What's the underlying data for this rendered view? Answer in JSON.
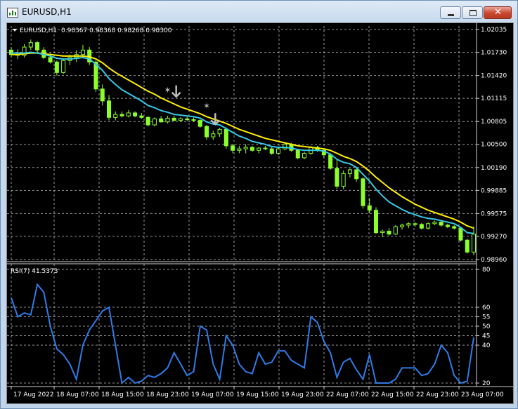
{
  "window": {
    "title": "EURUSD,H1",
    "minimize_glyph": "",
    "maximize_glyph": "",
    "close_glyph": "✕"
  },
  "main_panel": {
    "label_symbol": "EURUSD,H1",
    "label_values": "0.98367 0.98368 0.98268 0.98300",
    "price_levels": [
      "1.02035",
      "1.01730",
      "1.01420",
      "1.01115",
      "1.00805",
      "1.00500",
      "1.00190",
      "0.99885",
      "0.99575",
      "0.99270",
      "0.98960"
    ]
  },
  "rsi_panel": {
    "label": "RSI(7) 41.5373",
    "levels": [
      "80",
      "60",
      "55",
      "50",
      "45",
      "40",
      "20"
    ]
  },
  "time_axis": [
    "17 Aug 2022",
    "18 Aug 07:00",
    "18 Aug 15:00",
    "18 Aug 23:00",
    "19 Aug 07:00",
    "19 Aug 15:00",
    "19 Aug 23:00",
    "22 Aug 07:00",
    "22 Aug 15:00",
    "22 Aug 23:00",
    "23 Aug 07:00"
  ],
  "colors": {
    "background": "#000000",
    "grid": "#c8c8c8",
    "bull": "#8cff2a",
    "bear": "#8cff2a",
    "ma_fast": "#35c8e6",
    "ma_slow": "#ffee00",
    "rsi": "#2f7be8",
    "arrow": "#bdbdbd"
  },
  "icons": {
    "app": "chart-window-icon",
    "panel_marker": "triangle-down-icon",
    "signals": "down-arrow-icon"
  },
  "chart_data": {
    "type": "candlestick",
    "symbol": "EURUSD",
    "timeframe": "H1",
    "ylim": [
      0.9896,
      1.02035
    ],
    "ohlc": [
      [
        1.0176,
        1.018,
        1.0166,
        1.017
      ],
      [
        1.017,
        1.0177,
        1.0164,
        1.0169
      ],
      [
        1.0169,
        1.0184,
        1.0166,
        1.018
      ],
      [
        1.018,
        1.019,
        1.0176,
        1.0186
      ],
      [
        1.0186,
        1.0188,
        1.0173,
        1.0176
      ],
      [
        1.0176,
        1.018,
        1.0164,
        1.0166
      ],
      [
        1.0166,
        1.0172,
        1.0158,
        1.016
      ],
      [
        1.016,
        1.0162,
        1.0142,
        1.0146
      ],
      [
        1.0146,
        1.0164,
        1.0144,
        1.0162
      ],
      [
        1.0162,
        1.017,
        1.0156,
        1.0166
      ],
      [
        1.0166,
        1.0176,
        1.016,
        1.017
      ],
      [
        1.017,
        1.0183,
        1.0165,
        1.0176
      ],
      [
        1.0176,
        1.018,
        1.0156,
        1.016
      ],
      [
        1.016,
        1.0162,
        1.012,
        1.0124
      ],
      [
        1.0124,
        1.013,
        1.0102,
        1.0108
      ],
      [
        1.0108,
        1.0116,
        1.0082,
        1.0086
      ],
      [
        1.0086,
        1.0094,
        1.0082,
        1.009
      ],
      [
        1.009,
        1.0094,
        1.0086,
        1.0088
      ],
      [
        1.0088,
        1.0096,
        1.0086,
        1.0092
      ],
      [
        1.0092,
        1.0094,
        1.0086,
        1.0088
      ],
      [
        1.0088,
        1.0092,
        1.0084,
        1.0086
      ],
      [
        1.0086,
        1.0088,
        1.0074,
        1.0076
      ],
      [
        1.0076,
        1.0086,
        1.0074,
        1.0084
      ],
      [
        1.0084,
        1.0088,
        1.0079,
        1.008
      ],
      [
        1.008,
        1.0088,
        1.0078,
        1.0085
      ],
      [
        1.0085,
        1.0088,
        1.0081,
        1.0082
      ],
      [
        1.0082,
        1.0086,
        1.008,
        1.0084
      ],
      [
        1.0084,
        1.0087,
        1.0081,
        1.0083
      ],
      [
        1.0083,
        1.0086,
        1.008,
        1.0082
      ],
      [
        1.0082,
        1.0085,
        1.0072,
        1.0074
      ],
      [
        1.0074,
        1.0076,
        1.0056,
        1.006
      ],
      [
        1.006,
        1.0068,
        1.0056,
        1.0064
      ],
      [
        1.0064,
        1.0072,
        1.006,
        1.007
      ],
      [
        1.007,
        1.0072,
        1.0044,
        1.0048
      ],
      [
        1.0048,
        1.005,
        1.0038,
        1.0042
      ],
      [
        1.0042,
        1.0048,
        1.0038,
        1.0044
      ],
      [
        1.0044,
        1.005,
        1.0038,
        1.0046
      ],
      [
        1.0046,
        1.0048,
        1.004,
        1.0042
      ],
      [
        1.0042,
        1.0046,
        1.0038,
        1.0045
      ],
      [
        1.0045,
        1.0048,
        1.0042,
        1.0044
      ],
      [
        1.0044,
        1.0046,
        1.0036,
        1.0038
      ],
      [
        1.0038,
        1.0046,
        1.0036,
        1.0044
      ],
      [
        1.0044,
        1.0052,
        1.0042,
        1.005
      ],
      [
        1.005,
        1.0052,
        1.004,
        1.0042
      ],
      [
        1.0042,
        1.0044,
        1.003,
        1.0032
      ],
      [
        1.0032,
        1.004,
        1.003,
        1.0038
      ],
      [
        1.0038,
        1.0048,
        1.0036,
        1.0046
      ],
      [
        1.0046,
        1.0048,
        1.004,
        1.0042
      ],
      [
        1.0042,
        1.0044,
        1.0032,
        1.0036
      ],
      [
        1.0036,
        1.0038,
        1.0016,
        1.0018
      ],
      [
        1.0018,
        1.003,
        0.999,
        0.9994
      ],
      [
        0.9994,
        1.0015,
        0.999,
        1.0011
      ],
      [
        1.0011,
        1.0018,
        1.0006,
        1.0016
      ],
      [
        1.0016,
        1.002,
        1.0,
        1.0004
      ],
      [
        1.0004,
        1.0006,
        0.9964,
        0.9968
      ],
      [
        0.9968,
        0.9978,
        0.9958,
        0.9962
      ],
      [
        0.9962,
        0.9966,
        0.993,
        0.9932
      ],
      [
        0.9932,
        0.9936,
        0.9926,
        0.9934
      ],
      [
        0.9934,
        0.9938,
        0.9928,
        0.993
      ],
      [
        0.993,
        0.9942,
        0.9929,
        0.994
      ],
      [
        0.994,
        0.9944,
        0.9936,
        0.9942
      ],
      [
        0.9942,
        0.9946,
        0.9938,
        0.9944
      ],
      [
        0.9944,
        0.9946,
        0.994,
        0.9943
      ],
      [
        0.9943,
        0.9945,
        0.9936,
        0.9938
      ],
      [
        0.9938,
        0.9946,
        0.9936,
        0.9944
      ],
      [
        0.9944,
        0.9948,
        0.9942,
        0.9946
      ],
      [
        0.9946,
        0.9947,
        0.994,
        0.9942
      ],
      [
        0.9942,
        0.9944,
        0.9938,
        0.994
      ],
      [
        0.994,
        0.9942,
        0.9936,
        0.9938
      ],
      [
        0.9938,
        0.994,
        0.992,
        0.9922
      ],
      [
        0.9922,
        0.9924,
        0.9904,
        0.9906
      ],
      [
        0.9906,
        0.994,
        0.9902,
        0.993
      ]
    ],
    "ma_fast": [
      1.0172,
      1.0172,
      1.0172,
      1.0173,
      1.0172,
      1.017,
      1.0168,
      1.0165,
      1.0164,
      1.0164,
      1.0165,
      1.0166,
      1.0164,
      1.0157,
      1.0149,
      1.0138,
      1.013,
      1.0123,
      1.0118,
      1.0113,
      1.0108,
      1.0102,
      1.0099,
      1.0095,
      1.0093,
      1.009,
      1.0089,
      1.0088,
      1.0087,
      1.0085,
      1.008,
      1.0077,
      1.0076,
      1.0071,
      1.0066,
      1.0061,
      1.0058,
      1.0054,
      1.0052,
      1.005,
      1.0047,
      1.0046,
      1.0046,
      1.0045,
      1.0043,
      1.0042,
      1.0042,
      1.0042,
      1.0041,
      1.0037,
      1.003,
      1.0026,
      1.0024,
      1.0019,
      1.001,
      1.0001,
      0.999,
      0.9981,
      0.9973,
      0.9968,
      0.9963,
      0.9959,
      0.9956,
      0.9953,
      0.9951,
      0.995,
      0.9948,
      0.9946,
      0.9944,
      0.9939,
      0.9932,
      0.9931
    ],
    "ma_slow": [
      1.017,
      1.017,
      1.0171,
      1.0172,
      1.0172,
      1.0171,
      1.017,
      1.0169,
      1.0168,
      1.0168,
      1.0168,
      1.0168,
      1.0167,
      1.0164,
      1.0159,
      1.0152,
      1.0146,
      1.0141,
      1.0136,
      1.0131,
      1.0126,
      1.0121,
      1.0117,
      1.0112,
      1.0108,
      1.0104,
      1.01,
      1.0097,
      1.0094,
      1.0091,
      1.0087,
      1.0084,
      1.0081,
      1.0078,
      1.0074,
      1.007,
      1.0067,
      1.0064,
      1.0061,
      1.0058,
      1.0056,
      1.0054,
      1.0052,
      1.005,
      1.0048,
      1.0047,
      1.0046,
      1.0045,
      1.0044,
      1.0042,
      1.0038,
      1.0034,
      1.0031,
      1.0027,
      1.0021,
      1.0014,
      1.0006,
      0.9999,
      0.9992,
      0.9986,
      0.998,
      0.9975,
      0.997,
      0.9966,
      0.9962,
      0.9959,
      0.9956,
      0.9953,
      0.995,
      0.9946,
      0.9941,
      0.9938
    ],
    "signal_arrows": [
      {
        "index": 25,
        "price": 1.011
      },
      {
        "index": 31,
        "price": 1.0073
      }
    ],
    "signal_stars": [
      {
        "index": 24,
        "price": 1.0111
      },
      {
        "index": 30,
        "price": 1.009
      }
    ],
    "rsi": {
      "ylim": [
        20,
        80
      ],
      "values": [
        65,
        55,
        57,
        56,
        72,
        68,
        50,
        38,
        35,
        30,
        22,
        40,
        48,
        53,
        58,
        60,
        40,
        20,
        23,
        18,
        21,
        24,
        23,
        25,
        28,
        36,
        30,
        24,
        26,
        50,
        48,
        30,
        22,
        45,
        40,
        30,
        26,
        25,
        36,
        30,
        31,
        37,
        37,
        32,
        30,
        28,
        55,
        52,
        42,
        36,
        23,
        31,
        33,
        27,
        22,
        35,
        20,
        18,
        19,
        22,
        28,
        28,
        28,
        24,
        25,
        30,
        40,
        36,
        24,
        20,
        21,
        44
      ]
    }
  }
}
